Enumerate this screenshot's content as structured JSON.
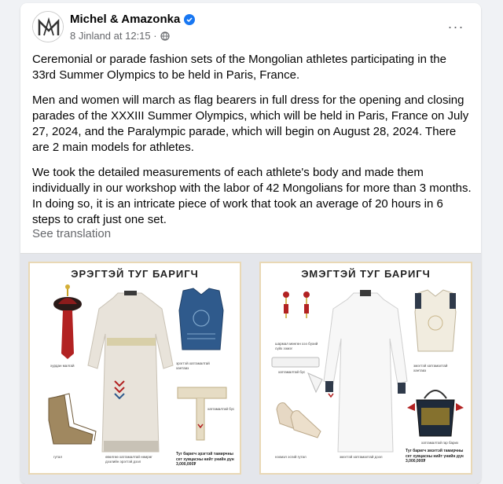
{
  "post": {
    "author": "Michel & Amazonka",
    "timestamp": "8 Jinland at 12:15 ·",
    "paragraphs": [
      "Ceremonial or parade fashion sets of the Mongolian athletes participating in the 33rd Summer Olympics to be held in Paris, France.",
      "Men and women will march as flag bearers in full dress for the opening and closing parades of the XXXIII Summer Olympics, which will be held in Paris, France on July 27, 2024, and the Paralympic parade, which will begin on August 28, 2024. There are 2 main models for athletes.",
      "We took the detailed measurements of each athlete's body and made them individually in our workshop with the labor of 42 Mongolians for more than 3 months. In doing so, it is an intricate piece of work that took an average of 20 hours in 6 steps to craft just one set."
    ],
    "see_translation": "See translation",
    "more_label": "···"
  },
  "panels": {
    "left": {
      "title": "ЭРЭГТЭЙ ТУГ БАРИГЧ",
      "caption_hat": "хурдан малгай",
      "caption_vest": "эрэгтэй хатгамалтай хантааз",
      "caption_belt": "хатгамалтай бүс",
      "caption_robe": "өвөлгөө хатгамалтай нөмрөг дээлийн эрэгтэй дээл",
      "caption_boots": "гутал",
      "price": "Туг баригч эрэгтэй тамирчны сет хувцасны нийт үнийн дүн 3,000,000₮"
    },
    "right": {
      "title": "ЭМЭГТЭЙ ТУГ БАРИГЧ",
      "caption_earrings": "шармал мөнгөн хээ бүхий сүйх ээмэг",
      "caption_belt": "хатгамалтай бүс",
      "caption_shoes": "нэхмэл эсгий гутал",
      "caption_robe": "эмэгтэй хатгамалтай дээл",
      "caption_vest": "эмэгтэй хатгамалтай хантааз",
      "caption_bag": "хатгамалтай гар барих",
      "price": "Туг баригч эмэгтэй тамирчны сет хувцасны нийт үнийн дүн 3,000,000₮"
    }
  },
  "colors": {
    "verified": "#1877f2",
    "panel_border": "#e9d8b5",
    "vest_blue": "#2f5a8c"
  }
}
